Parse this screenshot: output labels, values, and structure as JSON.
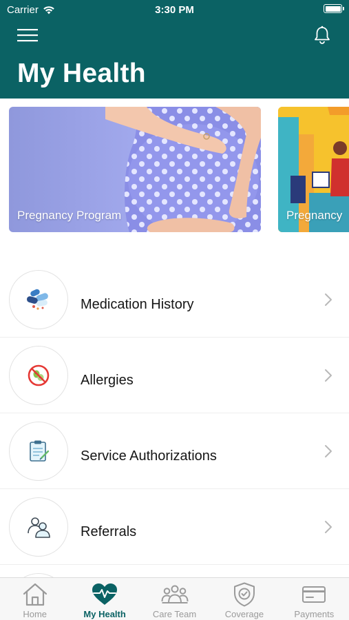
{
  "status_bar": {
    "carrier": "Carrier",
    "time": "3:30 PM"
  },
  "header": {
    "title": "My Health",
    "menu_icon": "hamburger-menu-icon",
    "notification_icon": "bell-icon"
  },
  "colors": {
    "header": "#0b6264",
    "active_tab": "#0b6264",
    "inactive_tab": "#9a9a9a"
  },
  "carousel": [
    {
      "label": "Pregnancy Program"
    },
    {
      "label": "Pregnancy"
    }
  ],
  "menu_items": [
    {
      "label": "Medication History",
      "icon": "pills-icon"
    },
    {
      "label": "Allergies",
      "icon": "allergy-icon"
    },
    {
      "label": "Service Authorizations",
      "icon": "clipboard-icon"
    },
    {
      "label": "Referrals",
      "icon": "referral-people-icon"
    }
  ],
  "tabs": [
    {
      "label": "Home",
      "icon": "home-icon",
      "active": false
    },
    {
      "label": "My Health",
      "icon": "heart-pulse-icon",
      "active": true
    },
    {
      "label": "Care Team",
      "icon": "care-team-icon",
      "active": false
    },
    {
      "label": "Coverage",
      "icon": "shield-check-icon",
      "active": false
    },
    {
      "label": "Payments",
      "icon": "credit-card-icon",
      "active": false
    }
  ]
}
